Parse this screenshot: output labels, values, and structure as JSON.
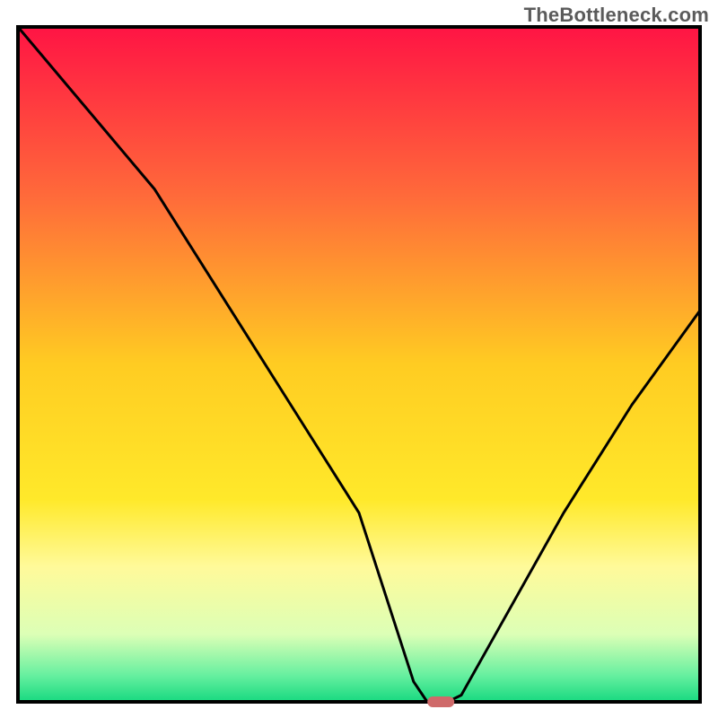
{
  "watermark": "TheBottleneck.com",
  "chart_data": {
    "type": "line",
    "title": "",
    "xlabel": "",
    "ylabel": "",
    "xlim": [
      0,
      100
    ],
    "ylim": [
      0,
      100
    ],
    "series": [
      {
        "name": "bottleneck-curve",
        "x": [
          0,
          10,
          20,
          30,
          40,
          50,
          58,
          60,
          63,
          65,
          70,
          80,
          90,
          100
        ],
        "y": [
          100,
          88,
          76,
          60,
          44,
          28,
          3,
          0,
          0,
          1,
          10,
          28,
          44,
          58
        ]
      }
    ],
    "marker": {
      "x": 62,
      "y": 0,
      "color": "#cf6a6a"
    },
    "gradient_stops": [
      {
        "offset": 0.0,
        "color": "#ff1444"
      },
      {
        "offset": 0.25,
        "color": "#ff6a3a"
      },
      {
        "offset": 0.5,
        "color": "#ffcc22"
      },
      {
        "offset": 0.7,
        "color": "#ffe92a"
      },
      {
        "offset": 0.8,
        "color": "#fffa9a"
      },
      {
        "offset": 0.9,
        "color": "#dcffb6"
      },
      {
        "offset": 0.96,
        "color": "#68f0a0"
      },
      {
        "offset": 1.0,
        "color": "#17d980"
      }
    ],
    "curve_color": "#000000",
    "border_color": "#000000"
  }
}
